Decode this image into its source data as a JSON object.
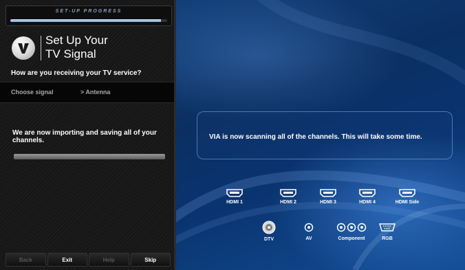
{
  "setup_progress": {
    "title": "SET-UP PROGRESS",
    "progress_percent": 96
  },
  "panel": {
    "heading_line1": "Set Up Your",
    "heading_line2": "TV Signal",
    "question": "How are you receiving your TV service?",
    "signal_label": "Choose signal",
    "signal_value": "> Antenna",
    "import_message": "We are now importing and saving all of your channels.",
    "logo_icon": "vizio-v-logo-icon"
  },
  "footer": {
    "back": "Back",
    "exit": "Exit",
    "help": "Help",
    "skip": "Skip"
  },
  "scan": {
    "message": "VIA is now scanning all of the channels. This will take some time."
  },
  "connections": {
    "hdmi1": "HDMI 1",
    "hdmi2": "HDMI 2",
    "hdmi3": "HDMI 3",
    "hdmi4": "HDMI 4",
    "hdmi_side": "HDMI Side",
    "dtv": "DTV",
    "av": "AV",
    "component": "Component",
    "rgb": "RGB"
  },
  "colors": {
    "accent_blue": "#0b2f63",
    "progress_fill": "#7fa6cf",
    "panel_dark": "#161616"
  }
}
